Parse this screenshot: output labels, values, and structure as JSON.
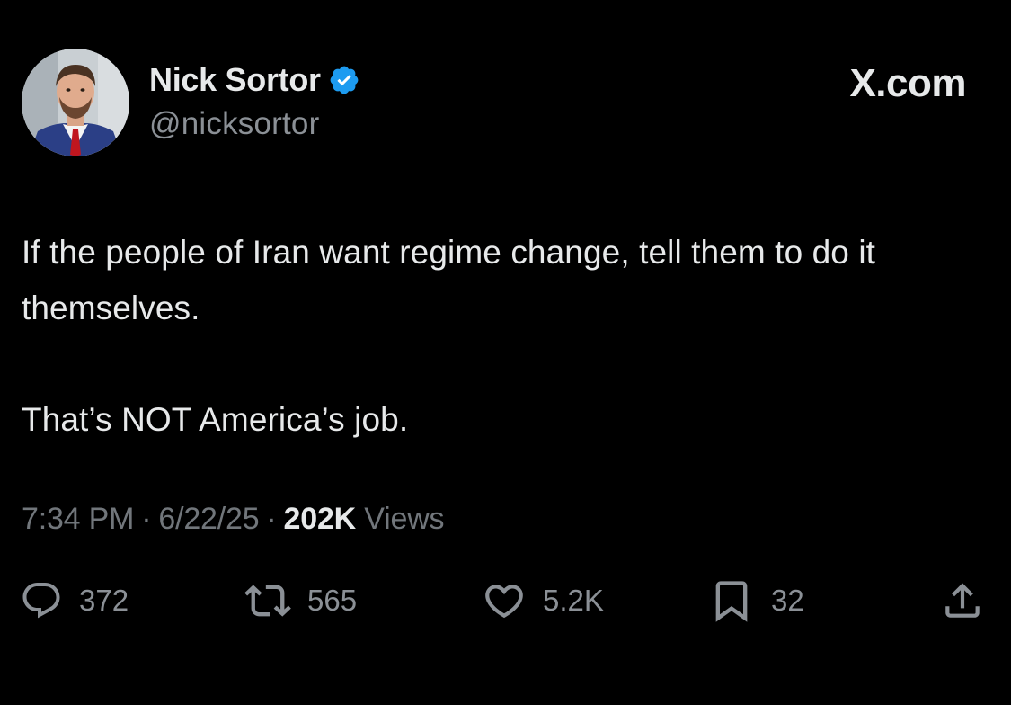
{
  "author": {
    "name": "Nick Sortor",
    "handle": "@nicksortor",
    "verified": true,
    "verified_color": "#1d9bf0"
  },
  "brand": "X.com",
  "tweet": {
    "paragraphs": [
      "If the people of Iran want regime change, tell them to do it themselves.",
      "That’s NOT America’s job."
    ]
  },
  "meta": {
    "time": "7:34 PM",
    "date": "6/22/25",
    "views_count": "202K",
    "views_label": "Views",
    "separator": "·"
  },
  "actions": {
    "replies": "372",
    "reposts": "565",
    "likes": "5.2K",
    "bookmarks": "32"
  },
  "icons": [
    "reply-icon",
    "repost-icon",
    "like-icon",
    "bookmark-icon",
    "share-icon",
    "verified-badge-icon"
  ]
}
